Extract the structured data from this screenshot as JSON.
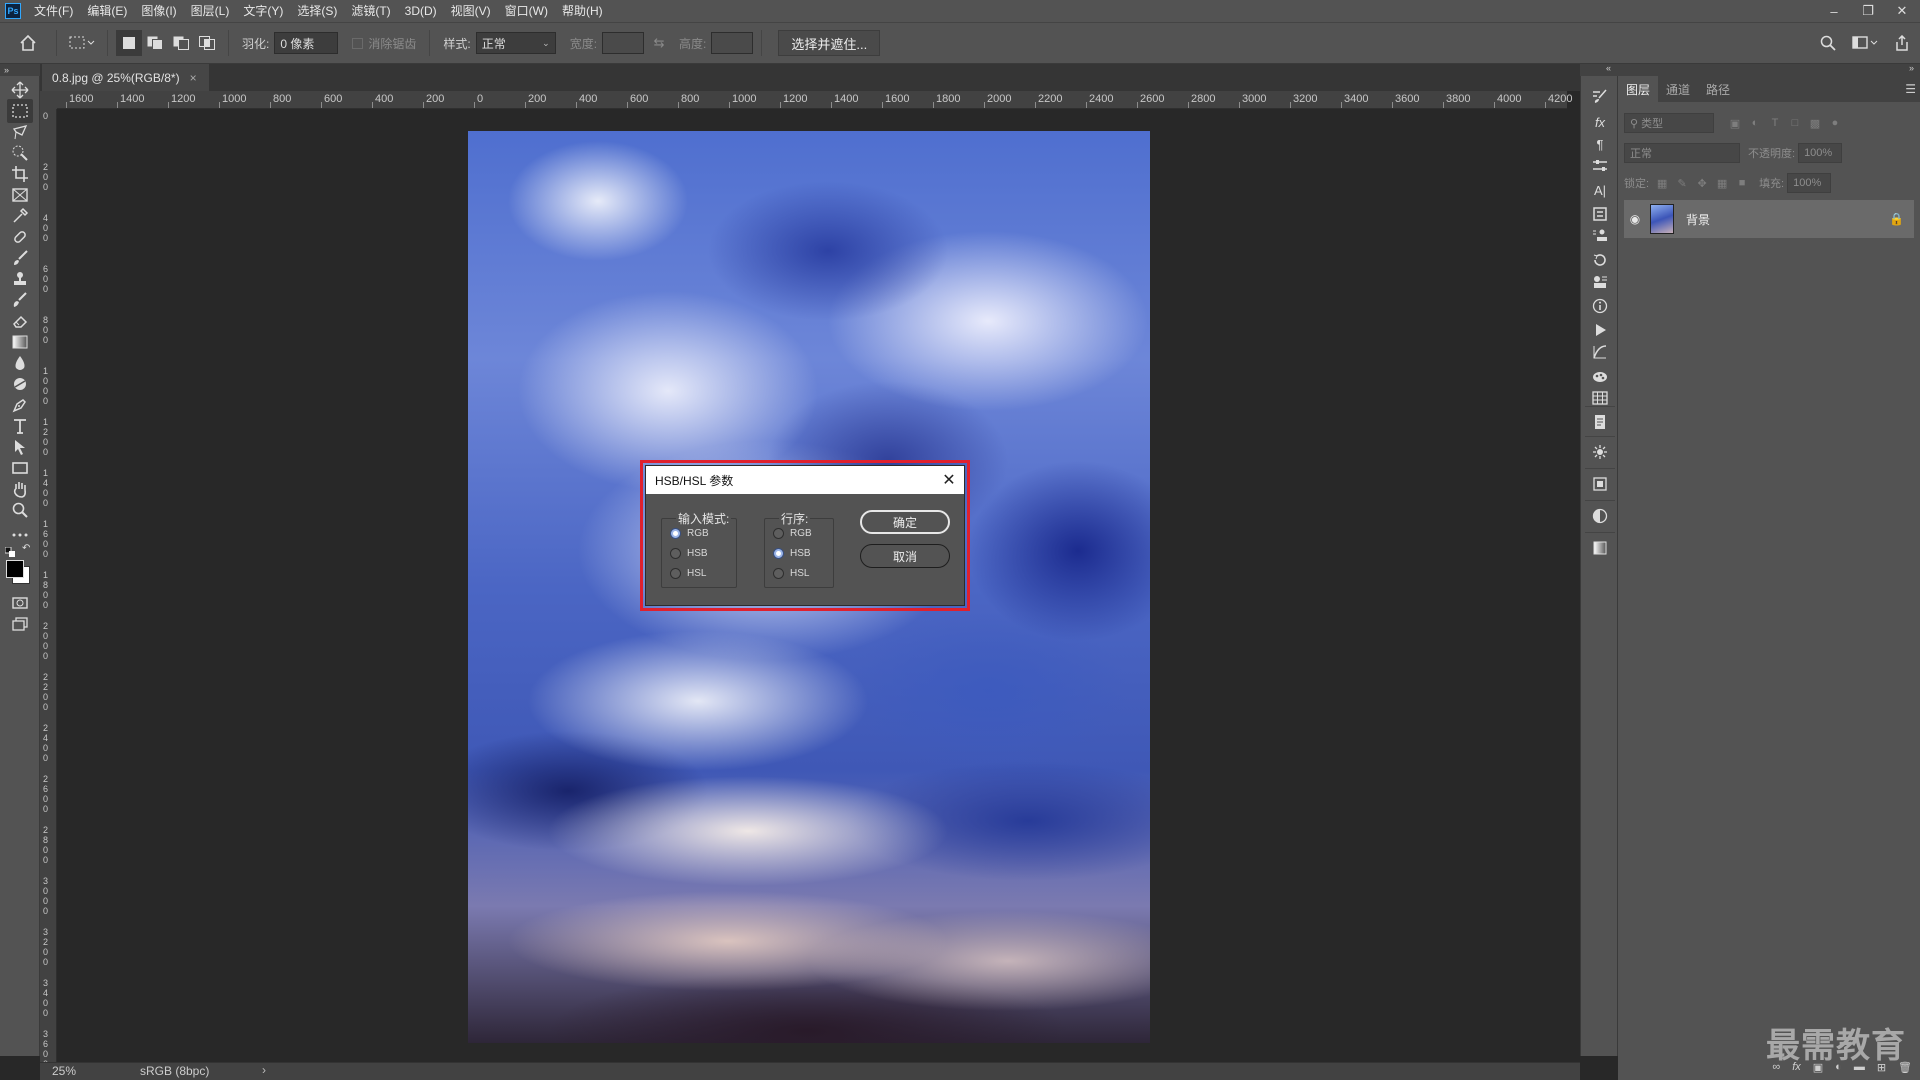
{
  "app": {
    "logo": "Ps"
  },
  "menu": [
    "文件(F)",
    "编辑(E)",
    "图像(I)",
    "图层(L)",
    "文字(Y)",
    "选择(S)",
    "滤镜(T)",
    "3D(D)",
    "视图(V)",
    "窗口(W)",
    "帮助(H)"
  ],
  "options": {
    "feather_label": "羽化:",
    "feather_value": "0 像素",
    "antialias_label": "消除锯齿",
    "style_label": "样式:",
    "style_value": "正常",
    "width_label": "宽度:",
    "height_label": "高度:",
    "select_mask_label": "选择并遮住..."
  },
  "document": {
    "tab_title": "0.8.jpg @ 25%(RGB/8*)",
    "close": "×"
  },
  "ruler": {
    "h_labels": [
      "1600",
      "1400",
      "1200",
      "1000",
      "800",
      "600",
      "400",
      "200",
      "0",
      "200",
      "400",
      "600",
      "800",
      "1000",
      "1200",
      "1400",
      "1600",
      "1800",
      "2000",
      "2200",
      "2400",
      "2600",
      "2800",
      "3000",
      "3200",
      "3400",
      "3600",
      "3800",
      "4000",
      "4200"
    ],
    "v_labels": [
      "0",
      "2\n0\n0",
      "4\n0\n0",
      "6\n0\n0",
      "8\n0\n0",
      "1\n0\n0\n0",
      "1\n2\n0\n0",
      "1\n4\n0\n0",
      "1\n6\n0\n0",
      "1\n8\n0\n0",
      "2\n0\n0\n0",
      "2\n2\n0\n0",
      "2\n4\n0\n0",
      "2\n6\n0\n0",
      "2\n8\n0\n0",
      "3\n0\n0\n0",
      "3\n2\n0\n0",
      "3\n4\n0\n0",
      "3\n6\n0\n0"
    ]
  },
  "dialog": {
    "title": "HSB/HSL 参数",
    "input_mode_label": "输入模式:",
    "input_mode_options": [
      "RGB",
      "HSB",
      "HSL"
    ],
    "input_mode_selected": "RGB",
    "order_label": "行序:",
    "order_options": [
      "RGB",
      "HSB",
      "HSL"
    ],
    "order_selected": "HSB",
    "ok_label": "确定",
    "cancel_label": "取消"
  },
  "layers_panel": {
    "tabs": [
      "图层",
      "通道",
      "路径"
    ],
    "active_tab": "图层",
    "filter_placeholder": "类型",
    "blend_mode": "正常",
    "opacity_label": "不透明度:",
    "opacity_value": "100%",
    "lock_label": "锁定:",
    "fill_label": "填充:",
    "fill_value": "100%",
    "layer_name": "背景"
  },
  "status": {
    "zoom": "25%",
    "color_profile": "sRGB (8bpc)",
    "arrow": "›"
  },
  "watermark": "最需教育",
  "colors": {
    "accent_highlight": "#e0202e",
    "ui_bg": "#535353",
    "canvas_bg": "#282828"
  }
}
